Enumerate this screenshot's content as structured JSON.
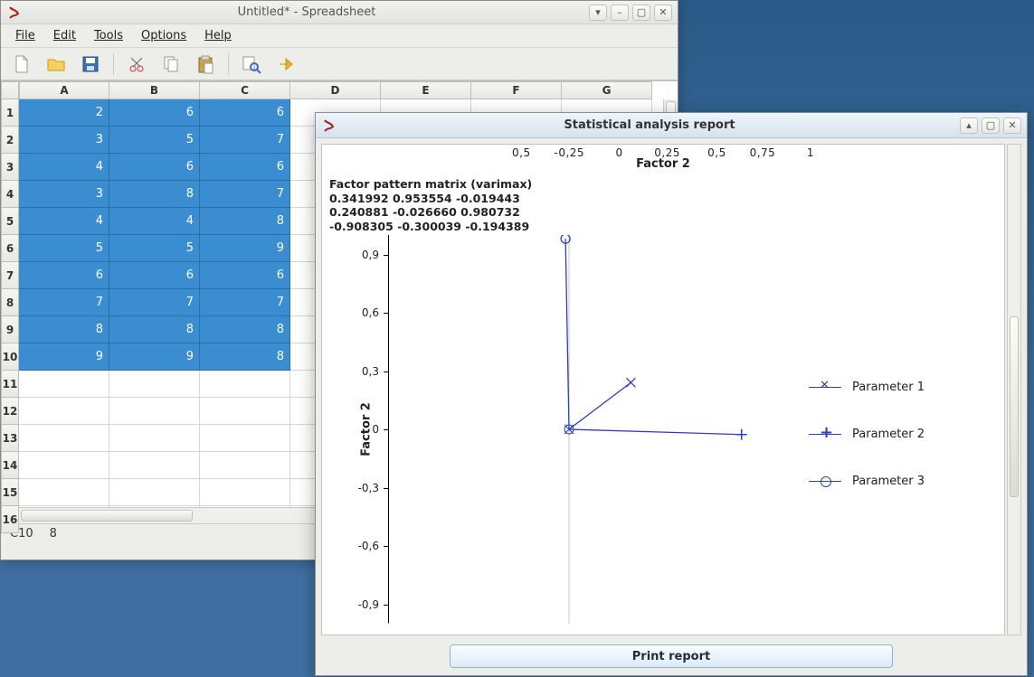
{
  "spreadsheet": {
    "title": "Untitled* - Spreadsheet",
    "menu": {
      "file": "File",
      "edit": "Edit",
      "tools": "Tools",
      "options": "Options",
      "help": "Help"
    },
    "columns": [
      "A",
      "B",
      "C",
      "D",
      "E",
      "F",
      "G"
    ],
    "rows": [
      "1",
      "2",
      "3",
      "4",
      "5",
      "6",
      "7",
      "8",
      "9",
      "10",
      "11",
      "12",
      "13",
      "14",
      "15",
      "16"
    ],
    "data": [
      [
        "2",
        "6",
        "6"
      ],
      [
        "3",
        "5",
        "7"
      ],
      [
        "4",
        "6",
        "6"
      ],
      [
        "3",
        "8",
        "7"
      ],
      [
        "4",
        "4",
        "8"
      ],
      [
        "5",
        "5",
        "9"
      ],
      [
        "6",
        "6",
        "6"
      ],
      [
        "7",
        "7",
        "7"
      ],
      [
        "8",
        "8",
        "8"
      ],
      [
        "9",
        "9",
        "8"
      ]
    ],
    "status": {
      "cell_ref": "C10",
      "cell_val": "8"
    }
  },
  "report": {
    "title": "Statistical analysis report",
    "top_axis_leftover": "0,5      -0,25        0        0,25       0,5      0,75        1",
    "top_label": "Factor 2",
    "matrix_title": "Factor pattern matrix (varimax)",
    "matrix_rows": [
      "0.341992 0.953554 -0.019443",
      "0.240881 -0.026660 0.980732",
      "-0.908305 -0.300039 -0.194389"
    ],
    "ylabel": "Factor 2",
    "yticks": [
      "0,9",
      "0,6",
      "0,3",
      "0",
      "-0,3",
      "-0,6",
      "-0,9"
    ],
    "legend": {
      "p1": "Parameter 1",
      "p2": "Parameter 2",
      "p3": "Parameter 3"
    },
    "print_label": "Print report"
  },
  "chart_data": {
    "type": "scatter",
    "title": "",
    "xlabel": "",
    "ylabel": "Factor 2",
    "ylim": [
      -1,
      1
    ],
    "series": [
      {
        "name": "Parameter 1",
        "marker": "x",
        "line_from_origin": true,
        "point": [
          0.341992,
          0.240881
        ]
      },
      {
        "name": "Parameter 2",
        "marker": "plus",
        "line_from_origin": true,
        "point": [
          0.953554,
          -0.02666
        ]
      },
      {
        "name": "Parameter 3",
        "marker": "circle",
        "line_from_origin": true,
        "point": [
          -0.019443,
          0.980732
        ]
      }
    ],
    "origin_marker": true
  }
}
